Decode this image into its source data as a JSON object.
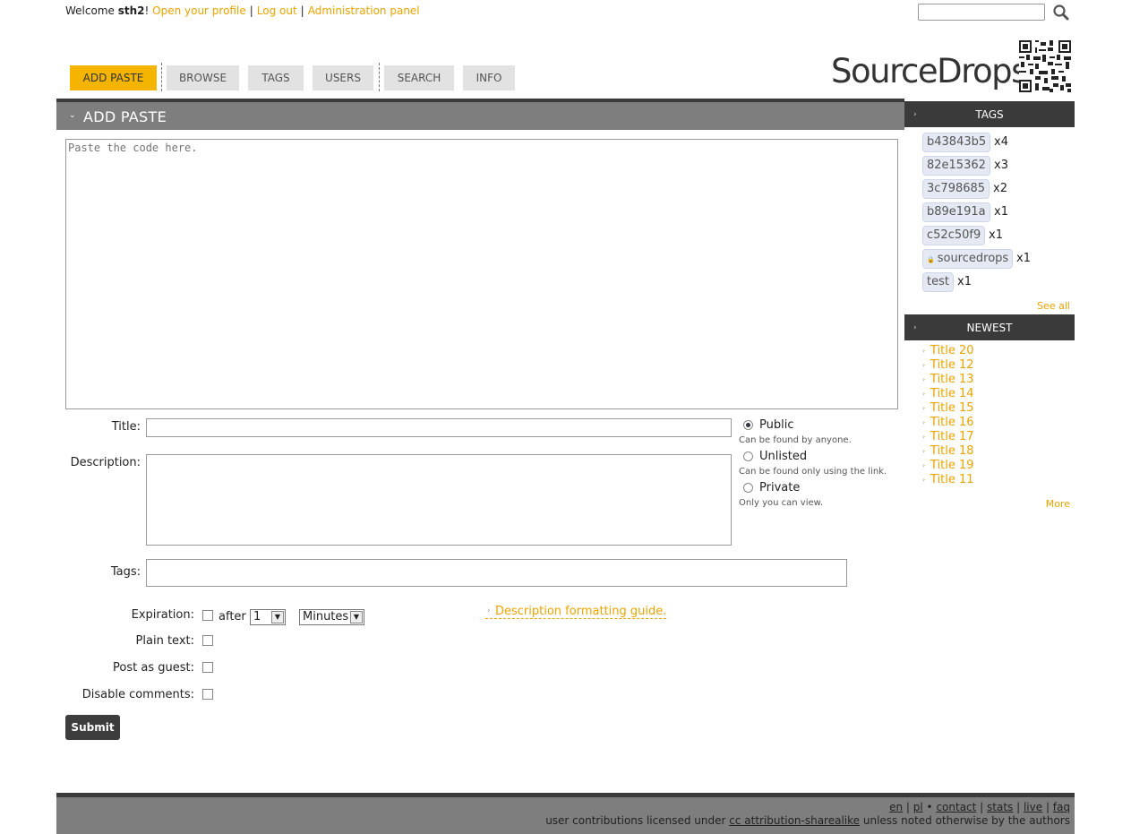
{
  "top": {
    "welcome": "Welcome",
    "username": "sth2",
    "exclaim": "!",
    "links": [
      "Open your profile",
      "Log out",
      "Administration panel"
    ]
  },
  "search": {
    "placeholder": "",
    "icon": "magnifier-icon"
  },
  "nav": [
    "ADD PASTE",
    "BROWSE",
    "TAGS",
    "USERS",
    "SEARCH",
    "INFO"
  ],
  "logo": {
    "text": "SourceDrops",
    "icon": "qr-code-icon"
  },
  "main": {
    "title": "ADD PASTE",
    "code_placeholder": "Paste the code here.",
    "title_label": "Title:",
    "description_label": "Description:",
    "tags_label": "Tags:",
    "visibility": [
      {
        "label": "Public",
        "hint": "Can be found by anyone.",
        "selected": true
      },
      {
        "label": "Unlisted",
        "hint": "Can be found only using the link.",
        "selected": false
      },
      {
        "label": "Private",
        "hint": "Only you can view.",
        "selected": false
      }
    ],
    "expiration_label": "Expiration:",
    "after": "after",
    "expiration_value": "1",
    "expiration_unit": "Minutes",
    "plain_text_label": "Plain text:",
    "guest_label": "Post as guest:",
    "comments_label": "Disable comments:",
    "guide": "Description formatting guide.",
    "submit": "Submit"
  },
  "sidebar": {
    "tags_title": "TAGS",
    "tags": [
      {
        "name": "b43843b5",
        "count": "x4"
      },
      {
        "name": "82e15362",
        "count": "x3"
      },
      {
        "name": "3c798685",
        "count": "x2"
      },
      {
        "name": "b89e191a",
        "count": "x1"
      },
      {
        "name": "c52c50f9",
        "count": "x1"
      },
      {
        "name": "sourcedrops",
        "count": "x1",
        "locked": true
      },
      {
        "name": "test",
        "count": "x1"
      }
    ],
    "see_all": "See all",
    "newest_title": "NEWEST",
    "newest": [
      "Title 20",
      "Title 12",
      "Title 13",
      "Title 14",
      "Title 15",
      "Title 16",
      "Title 17",
      "Title 18",
      "Title 19",
      "Title 11"
    ],
    "more": "More"
  },
  "footer": {
    "langs": [
      "en",
      "pl"
    ],
    "links": [
      "contact",
      "stats",
      "live",
      "faq"
    ],
    "license_pre": "user contributions licensed under",
    "license_link": "cc attribution-sharealike",
    "license_post": "unless noted otherwise by the authors"
  },
  "colors": {
    "accent": "#f4b400",
    "link": "#e8a400",
    "dark": "#3a3a3a",
    "bar": "#7e7e7e"
  }
}
